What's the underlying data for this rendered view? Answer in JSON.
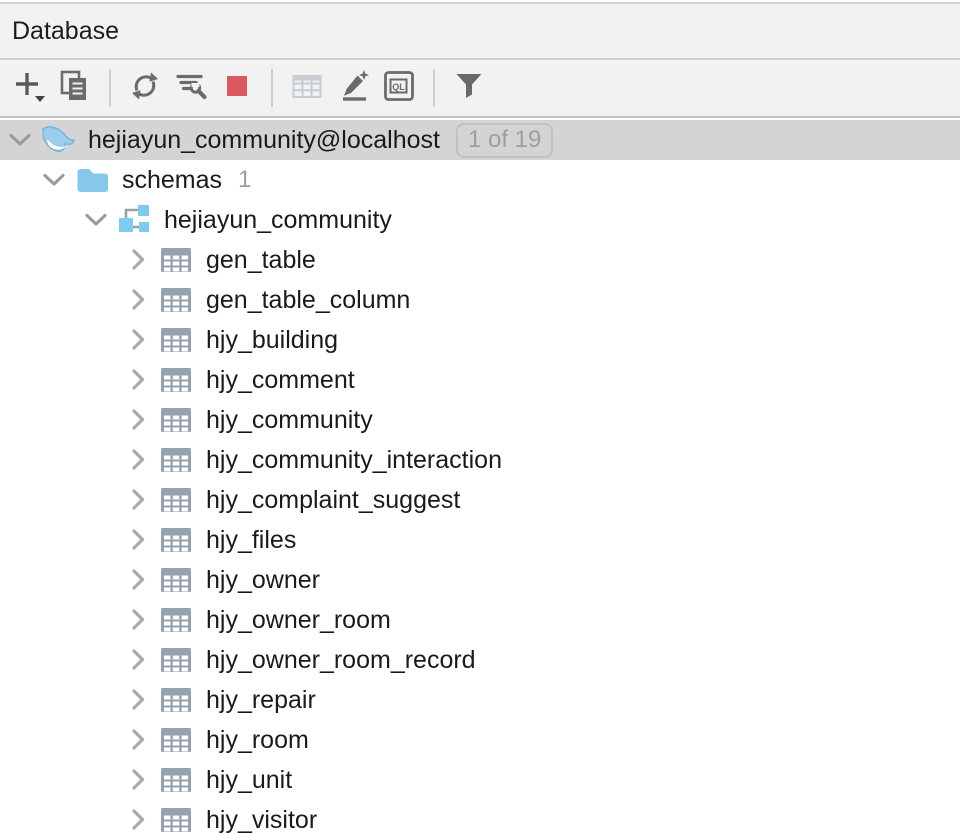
{
  "panel": {
    "title": "Database"
  },
  "toolbar": {
    "buttons": [
      {
        "name": "add-data-source",
        "icon": "plus-dropdown-icon"
      },
      {
        "name": "duplicate",
        "icon": "copy-icon"
      },
      {
        "name": "refresh",
        "icon": "refresh-icon"
      },
      {
        "name": "data-source-properties",
        "icon": "tornado-wrench-icon"
      },
      {
        "name": "stop",
        "icon": "stop-square-icon"
      },
      {
        "name": "open-table",
        "icon": "table-grid-icon",
        "disabled": true
      },
      {
        "name": "modify",
        "icon": "pencil-star-icon"
      },
      {
        "name": "query-console",
        "icon": "ql-console-icon",
        "label": "QL"
      },
      {
        "name": "filter",
        "icon": "funnel-icon"
      }
    ],
    "ql_label": "QL"
  },
  "tree": {
    "rows": [
      {
        "level": 0,
        "chevron": "down",
        "icon": "mysql",
        "label": "hejiayun_community@localhost",
        "badge": "1 of 19",
        "selected": true
      },
      {
        "level": 1,
        "chevron": "down",
        "icon": "folder",
        "label": "schemas",
        "count": "1"
      },
      {
        "level": 2,
        "chevron": "down",
        "icon": "schema",
        "label": "hejiayun_community"
      },
      {
        "level": 3,
        "chevron": "right",
        "icon": "table",
        "label": "gen_table"
      },
      {
        "level": 3,
        "chevron": "right",
        "icon": "table",
        "label": "gen_table_column"
      },
      {
        "level": 3,
        "chevron": "right",
        "icon": "table",
        "label": "hjy_building"
      },
      {
        "level": 3,
        "chevron": "right",
        "icon": "table",
        "label": "hjy_comment"
      },
      {
        "level": 3,
        "chevron": "right",
        "icon": "table",
        "label": "hjy_community"
      },
      {
        "level": 3,
        "chevron": "right",
        "icon": "table",
        "label": "hjy_community_interaction"
      },
      {
        "level": 3,
        "chevron": "right",
        "icon": "table",
        "label": "hjy_complaint_suggest"
      },
      {
        "level": 3,
        "chevron": "right",
        "icon": "table",
        "label": "hjy_files"
      },
      {
        "level": 3,
        "chevron": "right",
        "icon": "table",
        "label": "hjy_owner"
      },
      {
        "level": 3,
        "chevron": "right",
        "icon": "table",
        "label": "hjy_owner_room"
      },
      {
        "level": 3,
        "chevron": "right",
        "icon": "table",
        "label": "hjy_owner_room_record"
      },
      {
        "level": 3,
        "chevron": "right",
        "icon": "table",
        "label": "hjy_repair"
      },
      {
        "level": 3,
        "chevron": "right",
        "icon": "table",
        "label": "hjy_room"
      },
      {
        "level": 3,
        "chevron": "right",
        "icon": "table",
        "label": "hjy_unit"
      },
      {
        "level": 3,
        "chevron": "right",
        "icon": "table",
        "label": "hjy_visitor"
      }
    ]
  },
  "colors": {
    "panel_bg": "#f2f2f2",
    "selection": "#d4d4d4",
    "stop_red": "#db5860",
    "tree_blue": "#85c8ea",
    "table_gray": "#94a1ae",
    "muted_text": "#9e9e9e"
  }
}
